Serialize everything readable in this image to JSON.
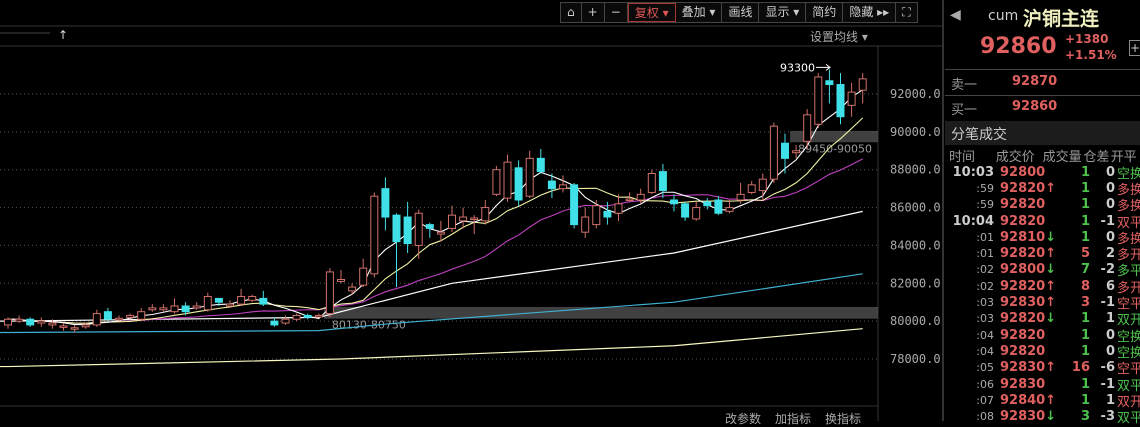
{
  "toolbar": {
    "items": [
      "复权 ▾",
      "叠加 ▾",
      "画线",
      "显示 ▾",
      "简约",
      "隐藏 ▸▸"
    ],
    "lock": "⌂",
    "plus": "+",
    "minus": "−",
    "fullscreen": "⛶"
  },
  "ma_settings": "设置均线 ▾",
  "up_arrow": "↑",
  "bottom_links": [
    "改参数",
    "加指标",
    "换指标"
  ],
  "colors": {
    "up": "#d0706a",
    "down": "#40e0e8",
    "ma5": "#ffffff",
    "ma10": "#f0f0a0",
    "ma20": "#c040c0",
    "ma_long1": "#ffffff",
    "ma_long2": "#40b0d0",
    "ma_long3": "#f8f8c0"
  },
  "chart_data": {
    "type": "candlestick",
    "ylim": [
      76500,
      93800
    ],
    "y_ticks": [
      "92000.0",
      "90000.0",
      "88000.0",
      "86000.0",
      "84000.0",
      "82000.0",
      "80000.0",
      "78000.0"
    ],
    "y_tick_values": [
      92000,
      90000,
      88000,
      86000,
      84000,
      82000,
      80000,
      78000
    ],
    "high_label": "93300",
    "zones": [
      {
        "label": "80130-80750",
        "low": 80130,
        "high": 80750,
        "from_index": 29
      },
      {
        "label": "89450-90050",
        "low": 89450,
        "high": 90050,
        "from_index": 71
      }
    ],
    "ohlc": [
      [
        79800,
        80100,
        80200,
        79600
      ],
      [
        80000,
        80100,
        80300,
        79900
      ],
      [
        80100,
        79800,
        80200,
        79700
      ],
      [
        79900,
        80000,
        80200,
        79700
      ],
      [
        79800,
        79900,
        80100,
        79600
      ],
      [
        79700,
        79750,
        79900,
        79500
      ],
      [
        79600,
        79650,
        79800,
        79400
      ],
      [
        79700,
        79800,
        79900,
        79600
      ],
      [
        79800,
        80400,
        80600,
        79700
      ],
      [
        80500,
        80100,
        80700,
        80000
      ],
      [
        80100,
        80150,
        80300,
        80000
      ],
      [
        80200,
        80300,
        80400,
        80100
      ],
      [
        80100,
        80500,
        80700,
        80000
      ],
      [
        80600,
        80700,
        80900,
        80500
      ],
      [
        80600,
        80700,
        80900,
        80500
      ],
      [
        80500,
        80800,
        81200,
        80400
      ],
      [
        80800,
        80500,
        81000,
        80300
      ],
      [
        80700,
        80800,
        81000,
        80600
      ],
      [
        80600,
        81300,
        81500,
        80500
      ],
      [
        81200,
        81000,
        81200,
        80800
      ],
      [
        80800,
        80900,
        81100,
        80700
      ],
      [
        80900,
        81300,
        81700,
        80800
      ],
      [
        81100,
        81300,
        81400,
        81000
      ],
      [
        81200,
        80900,
        81600,
        80800
      ],
      [
        80000,
        79800,
        80200,
        79700
      ],
      [
        79900,
        80100,
        80300,
        79800
      ],
      [
        80100,
        80300,
        80400,
        80000
      ],
      [
        80300,
        80200,
        80400,
        80100
      ],
      [
        80250,
        80300,
        80400,
        80200
      ],
      [
        80400,
        82600,
        82800,
        80200
      ],
      [
        82100,
        82200,
        82700,
        82000
      ],
      [
        81600,
        81800,
        82000,
        81400
      ],
      [
        81900,
        82800,
        83300,
        81800
      ],
      [
        82500,
        86600,
        86800,
        82300
      ],
      [
        87000,
        85500,
        87600,
        84800
      ],
      [
        85600,
        84200,
        85700,
        81800
      ],
      [
        85500,
        84100,
        86300,
        83600
      ],
      [
        84000,
        85700,
        85900,
        83300
      ],
      [
        85100,
        84900,
        85200,
        84400
      ],
      [
        84600,
        84700,
        85300,
        84200
      ],
      [
        84900,
        85600,
        86100,
        84700
      ],
      [
        85300,
        85500,
        86000,
        84900
      ],
      [
        85400,
        85450,
        85600,
        84600
      ],
      [
        85300,
        86000,
        86400,
        85100
      ],
      [
        86700,
        88000,
        88200,
        86600
      ],
      [
        86500,
        88400,
        88800,
        86300
      ],
      [
        88100,
        86400,
        88500,
        86100
      ],
      [
        86600,
        88600,
        89000,
        86500
      ],
      [
        88600,
        87900,
        89100,
        87800
      ],
      [
        87400,
        87000,
        87800,
        86500
      ],
      [
        87000,
        87200,
        87700,
        86800
      ],
      [
        87200,
        85100,
        87300,
        84900
      ],
      [
        84700,
        85500,
        86000,
        84400
      ],
      [
        85100,
        86100,
        86400,
        84900
      ],
      [
        85800,
        85500,
        86300,
        85100
      ],
      [
        85700,
        86200,
        86700,
        85300
      ],
      [
        86400,
        86450,
        86800,
        86300
      ],
      [
        86400,
        86700,
        87000,
        86200
      ],
      [
        86800,
        87800,
        88000,
        86700
      ],
      [
        87900,
        86900,
        88300,
        86500
      ],
      [
        86400,
        86200,
        86700,
        85800
      ],
      [
        86200,
        85500,
        86300,
        85300
      ],
      [
        85400,
        86000,
        86300,
        85300
      ],
      [
        86300,
        86100,
        86500,
        85900
      ],
      [
        86400,
        85700,
        86600,
        85600
      ],
      [
        85800,
        86000,
        86400,
        85700
      ],
      [
        86400,
        86700,
        87300,
        86200
      ],
      [
        86800,
        87200,
        87400,
        86700
      ],
      [
        86900,
        87500,
        87800,
        86400
      ],
      [
        87500,
        90300,
        90500,
        87300
      ],
      [
        89400,
        88600,
        89900,
        87800
      ],
      [
        88900,
        89000,
        89300,
        88600
      ],
      [
        89500,
        90900,
        91200,
        89100
      ],
      [
        90400,
        92900,
        93100,
        90200
      ],
      [
        92700,
        92500,
        93300,
        91500
      ],
      [
        92500,
        90800,
        93100,
        90400
      ],
      [
        91400,
        92100,
        92600,
        90800
      ],
      [
        92200,
        92800,
        93100,
        91500
      ]
    ],
    "long_mas": [
      {
        "name": "ma_long1",
        "points": [
          [
            0,
            80000
          ],
          [
            28,
            80200
          ],
          [
            40,
            82000
          ],
          [
            60,
            83600
          ],
          [
            77,
            85800
          ]
        ]
      },
      {
        "name": "ma_long2",
        "points": [
          [
            0,
            79400
          ],
          [
            28,
            79500
          ],
          [
            35,
            79900
          ],
          [
            60,
            81000
          ],
          [
            77,
            82500
          ]
        ]
      },
      {
        "name": "ma_long3",
        "points": [
          [
            0,
            77600
          ],
          [
            30,
            78000
          ],
          [
            60,
            78700
          ],
          [
            77,
            79600
          ]
        ]
      }
    ]
  },
  "quote": {
    "back": "◀",
    "code": "cum",
    "name": "沪铜主连",
    "price": "92860",
    "change": "+1380",
    "change_pct": "+1.51%",
    "add": "+"
  },
  "book": [
    {
      "label": "卖一",
      "price": "92870"
    },
    {
      "label": "买一",
      "price": "92860"
    }
  ],
  "ticks_title": "分笔成交",
  "ticks_headers": [
    "时间",
    "成交价",
    "成交量",
    "仓差",
    "开平"
  ],
  "ticks": [
    {
      "time": "10:03",
      "price": "92800",
      "arrow": "",
      "vol": "1",
      "oi": "0",
      "type": "空换",
      "tc": "green",
      "big": true
    },
    {
      "time": ":59",
      "price": "92820",
      "arrow": "↑",
      "vol": "1",
      "oi": "0",
      "type": "多换",
      "tc": "red"
    },
    {
      "time": ":59",
      "price": "92820",
      "arrow": "",
      "vol": "1",
      "oi": "0",
      "type": "多换",
      "tc": "red"
    },
    {
      "time": "10:04",
      "price": "92820",
      "arrow": "",
      "vol": "1",
      "oi": "-1",
      "type": "双平",
      "tc": "red",
      "big": true
    },
    {
      "time": ":01",
      "price": "92810",
      "arrow": "↓",
      "vol": "1",
      "oi": "0",
      "type": "多换",
      "tc": "red"
    },
    {
      "time": ":01",
      "price": "92820",
      "arrow": "↑",
      "vol": "5",
      "oi": "2",
      "type": "多开",
      "tc": "red"
    },
    {
      "time": ":02",
      "price": "92800",
      "arrow": "↓",
      "vol": "7",
      "oi": "-2",
      "type": "多平",
      "tc": "green"
    },
    {
      "time": ":02",
      "price": "92820",
      "arrow": "↑",
      "vol": "8",
      "oi": "6",
      "type": "多开",
      "tc": "red"
    },
    {
      "time": ":03",
      "price": "92830",
      "arrow": "↑",
      "vol": "3",
      "oi": "-1",
      "type": "空平",
      "tc": "red"
    },
    {
      "time": ":03",
      "price": "92820",
      "arrow": "↓",
      "vol": "1",
      "oi": "1",
      "type": "双开",
      "tc": "green"
    },
    {
      "time": ":04",
      "price": "92820",
      "arrow": "",
      "vol": "1",
      "oi": "0",
      "type": "空换",
      "tc": "green"
    },
    {
      "time": ":04",
      "price": "92820",
      "arrow": "",
      "vol": "1",
      "oi": "0",
      "type": "空换",
      "tc": "green"
    },
    {
      "time": ":05",
      "price": "92830",
      "arrow": "↑",
      "vol": "16",
      "oi": "-6",
      "type": "空平",
      "tc": "red"
    },
    {
      "time": ":06",
      "price": "92830",
      "arrow": "",
      "vol": "1",
      "oi": "-1",
      "type": "双平",
      "tc": "green"
    },
    {
      "time": ":07",
      "price": "92840",
      "arrow": "↑",
      "vol": "1",
      "oi": "1",
      "type": "双开",
      "tc": "red"
    },
    {
      "time": ":08",
      "price": "92830",
      "arrow": "↓",
      "vol": "3",
      "oi": "-3",
      "type": "双平",
      "tc": "green"
    }
  ]
}
